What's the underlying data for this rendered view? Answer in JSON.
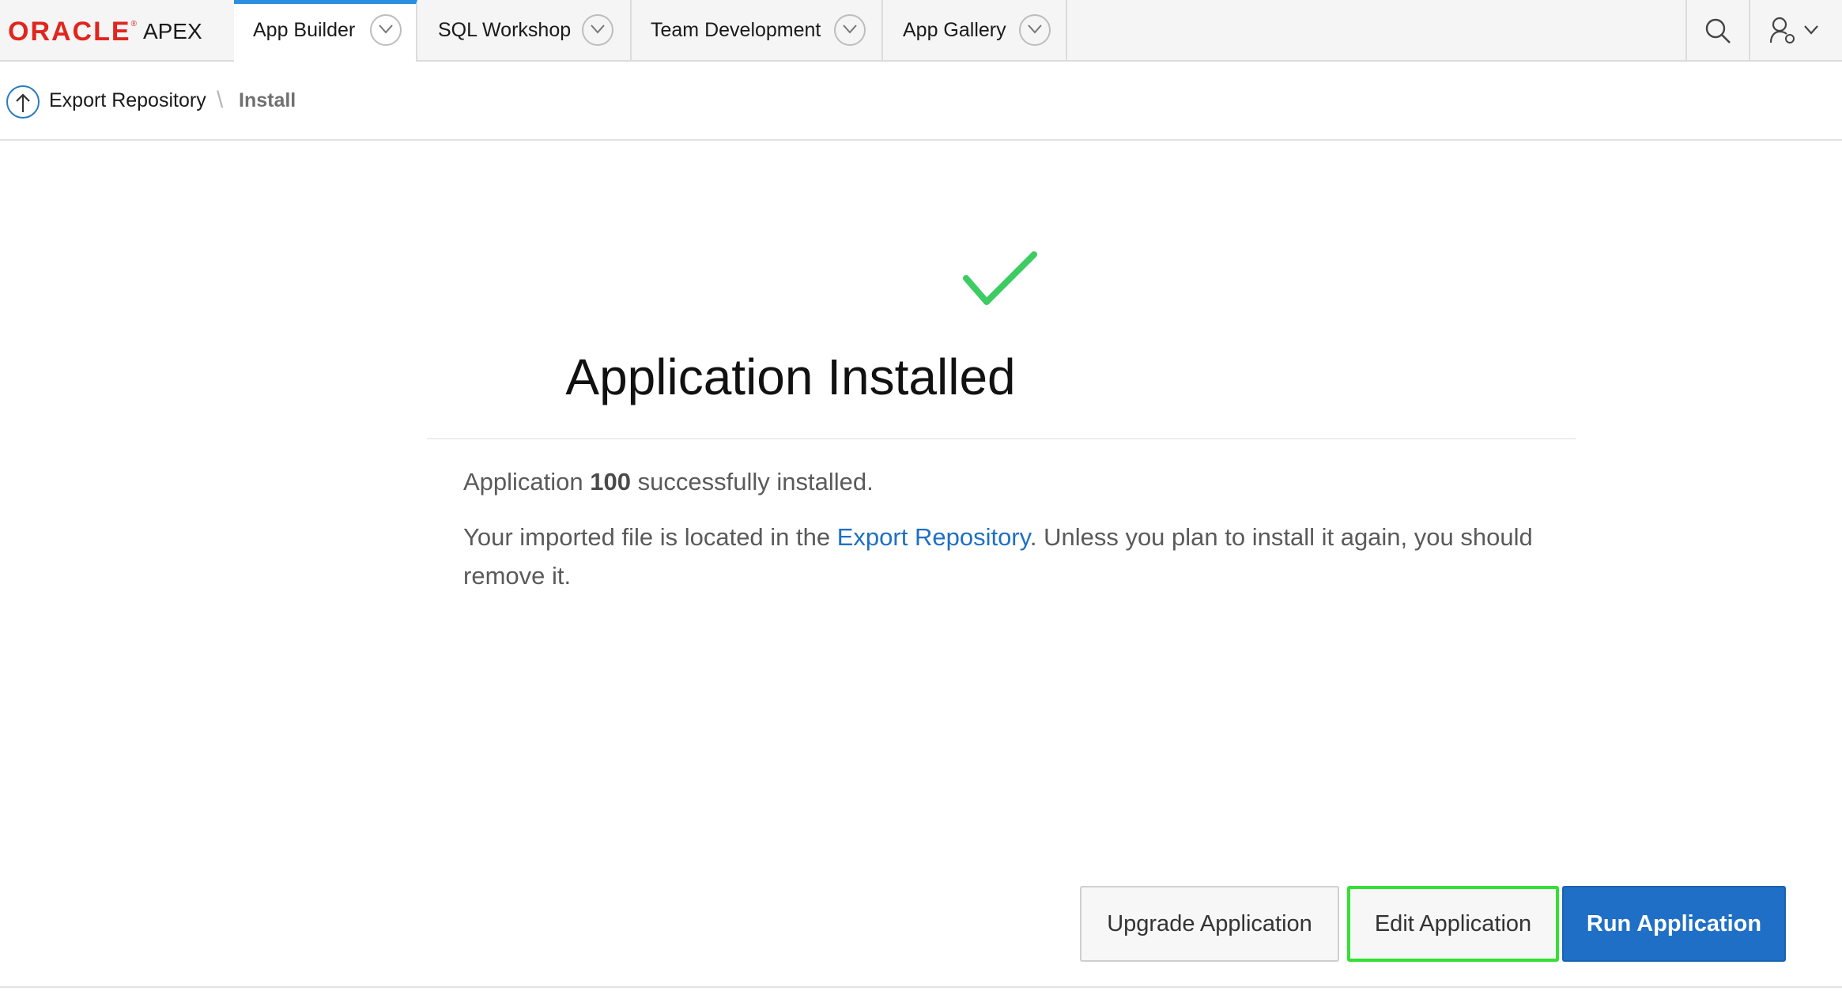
{
  "brand": {
    "oracle": "ORACLE",
    "registered": "®",
    "product": "APEX",
    "color": "#e0261e"
  },
  "nav": {
    "tabs": [
      {
        "label": "App Builder",
        "active": true
      },
      {
        "label": "SQL Workshop",
        "active": false
      },
      {
        "label": "Team Development",
        "active": false
      },
      {
        "label": "App Gallery",
        "active": false
      }
    ],
    "accent": "#2b8ee0",
    "icons": [
      "search-icon",
      "user-icon",
      "chevron-down-icon"
    ]
  },
  "breadcrumb": {
    "parent": "Export Repository",
    "separator": "\\",
    "current": "Install"
  },
  "main": {
    "title": "Application Installed",
    "message1": {
      "prefix": "Application ",
      "app_id": "100",
      "suffix": " successfully installed."
    },
    "message2": {
      "prefix": "Your imported file is located in the ",
      "link": "Export Repository",
      "suffix": ". Unless you plan to install it again, you should remove it."
    },
    "success_color": "#3dcc62"
  },
  "buttons": {
    "upgrade": "Upgrade Application",
    "edit": "Edit Application",
    "run": "Run Application",
    "primary_color": "#1f6fc6",
    "highlight_color": "#33e033"
  }
}
